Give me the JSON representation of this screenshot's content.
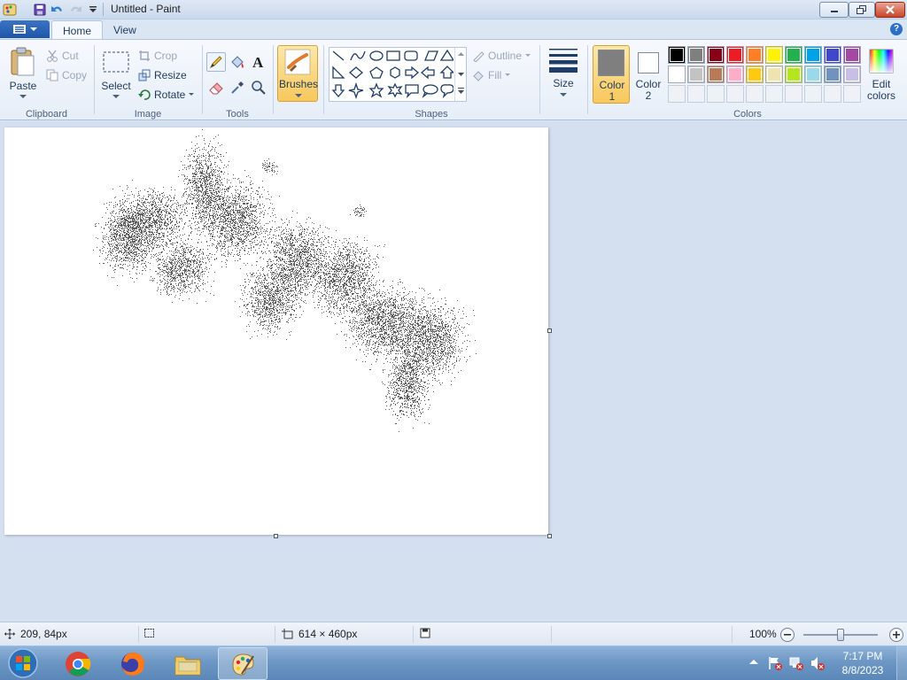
{
  "window": {
    "title": "Untitled - Paint"
  },
  "tabs": {
    "home": "Home",
    "view": "View"
  },
  "clipboard": {
    "paste": "Paste",
    "cut": "Cut",
    "copy": "Copy",
    "label": "Clipboard"
  },
  "image": {
    "select": "Select",
    "crop": "Crop",
    "resize": "Resize",
    "rotate": "Rotate",
    "label": "Image"
  },
  "tools": {
    "label": "Tools"
  },
  "brushes": {
    "label": "Brushes"
  },
  "shapes": {
    "outline": "Outline",
    "fill": "Fill",
    "label": "Shapes"
  },
  "size": {
    "label": "Size"
  },
  "colors": {
    "color1_label": "Color",
    "color1_num": "1",
    "color2_label": "Color",
    "color2_num": "2",
    "edit_label": "Edit",
    "edit_label2": "colors",
    "label": "Colors",
    "color1": "#7f7f7f",
    "color2": "#ffffff",
    "palette_row1": [
      "#000000",
      "#7f7f7f",
      "#880015",
      "#ed1c24",
      "#ff7f27",
      "#fff200",
      "#22b14c",
      "#00a2e8",
      "#3f48cc",
      "#a349a4"
    ],
    "palette_row2": [
      "#ffffff",
      "#c3c3c3",
      "#b97a57",
      "#ffaec9",
      "#ffc90e",
      "#efe4b0",
      "#b5e61d",
      "#99d9ea",
      "#7092be",
      "#c8bfe7"
    ]
  },
  "status": {
    "cursor_pos": "209, 84px",
    "canvas_size": "614 × 460px",
    "zoom": "100%",
    "zoom_level_fraction": 0.5
  },
  "taskbar": {
    "time": "7:17 PM",
    "date": "8/8/2023"
  }
}
